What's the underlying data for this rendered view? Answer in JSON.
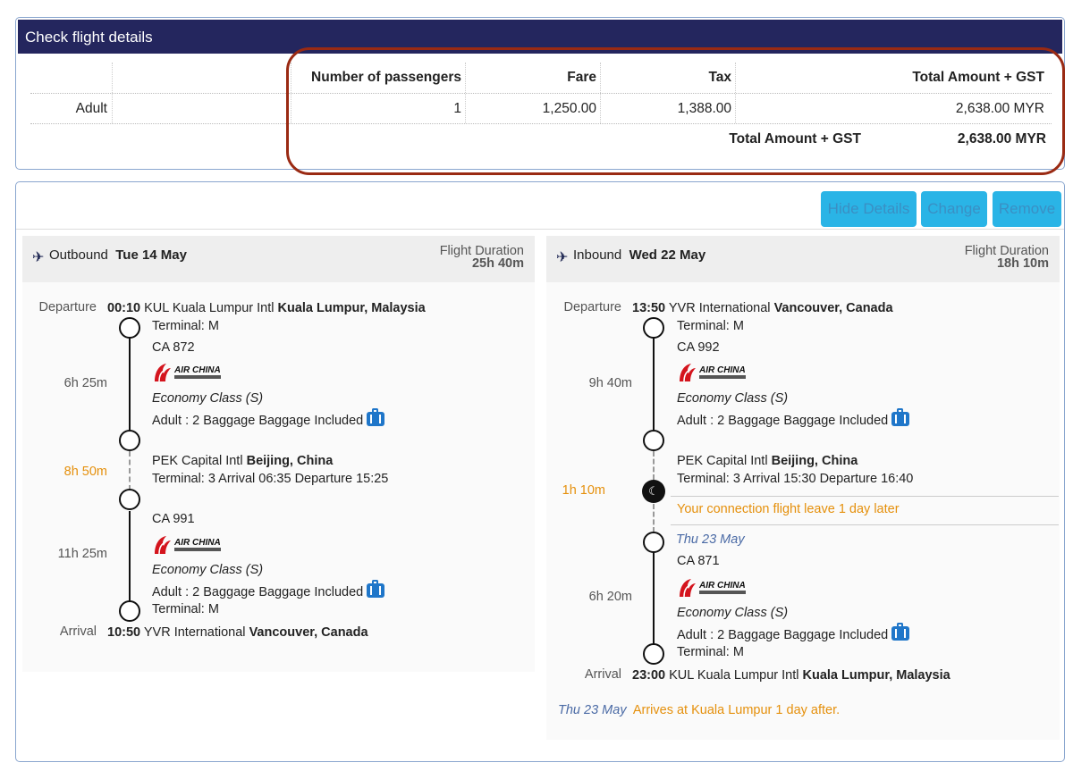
{
  "panel_title": "Check flight details",
  "fare_table": {
    "headers": {
      "passengers": "Number of passengers",
      "fare": "Fare",
      "tax": "Tax",
      "total": "Total Amount + GST"
    },
    "row": {
      "type": "Adult",
      "passengers": "1",
      "fare": "1,250.00",
      "tax": "1,388.00",
      "total": "2,638.00 MYR"
    },
    "summary": {
      "label": "Total Amount + GST",
      "value": "2,638.00 MYR"
    }
  },
  "buttons": {
    "hide_details": "Hide Details",
    "change": "Change",
    "remove": "Remove"
  },
  "outbound": {
    "direction": "Outbound",
    "date": "Tue 14 May",
    "duration_label": "Flight Duration",
    "duration": "25h 40m",
    "departure_label": "Departure",
    "departure_time": "00:10",
    "departure_airport": "KUL Kuala Lumpur Intl",
    "departure_city": "Kuala Lumpur, Malaysia",
    "departure_terminal": "Terminal: M",
    "leg1": {
      "flight": "CA 872",
      "duration": "6h 25m",
      "class": "Economy Class (S)",
      "baggage": "Adult : 2 Baggage Baggage Included"
    },
    "layover": {
      "duration": "8h 50m",
      "airport": "PEK Capital Intl",
      "city": "Beijing, China",
      "details": "Terminal: 3  Arrival 06:35 Departure 15:25"
    },
    "leg2": {
      "flight": "CA 991",
      "duration": "11h 25m",
      "class": "Economy Class (S)",
      "baggage": "Adult : 2 Baggage Baggage Included"
    },
    "arrival_terminal": "Terminal: M",
    "arrival_label": "Arrival",
    "arrival_time": "10:50",
    "arrival_airport": "YVR International",
    "arrival_city": "Vancouver, Canada"
  },
  "inbound": {
    "direction": "Inbound",
    "date": "Wed 22 May",
    "duration_label": "Flight Duration",
    "duration": "18h 10m",
    "departure_label": "Departure",
    "departure_time": "13:50",
    "departure_airport": "YVR International",
    "departure_city": "Vancouver, Canada",
    "departure_terminal": "Terminal: M",
    "leg1": {
      "flight": "CA 992",
      "duration": "9h 40m",
      "class": "Economy Class (S)",
      "baggage": "Adult : 2 Baggage Baggage Included"
    },
    "layover": {
      "duration": "1h 10m",
      "airport": "PEK Capital Intl",
      "city": "Beijing, China",
      "details": "Terminal: 3  Arrival 15:30 Departure 16:40",
      "notice": "Your connection flight leave 1 day later",
      "next_date": "Thu 23 May"
    },
    "leg2": {
      "flight": "CA 871",
      "duration": "6h 20m",
      "class": "Economy Class (S)",
      "baggage": "Adult : 2 Baggage Baggage Included"
    },
    "arrival_terminal": "Terminal: M",
    "arrival_label": "Arrival",
    "arrival_time": "23:00",
    "arrival_airport": "KUL Kuala Lumpur Intl",
    "arrival_city": "Kuala Lumpur, Malaysia",
    "footer_date": "Thu 23 May",
    "footer_note": "Arrives at Kuala Lumpur 1 day after."
  },
  "airline_logo": {
    "name": "AIR CHINA",
    "subtitle": "中国国际航空公司"
  },
  "colors": {
    "header_bg": "#24265e",
    "button_bg": "#2ab4e6",
    "accent_orange": "#e5900c",
    "highlight_border": "#9a2a13"
  }
}
